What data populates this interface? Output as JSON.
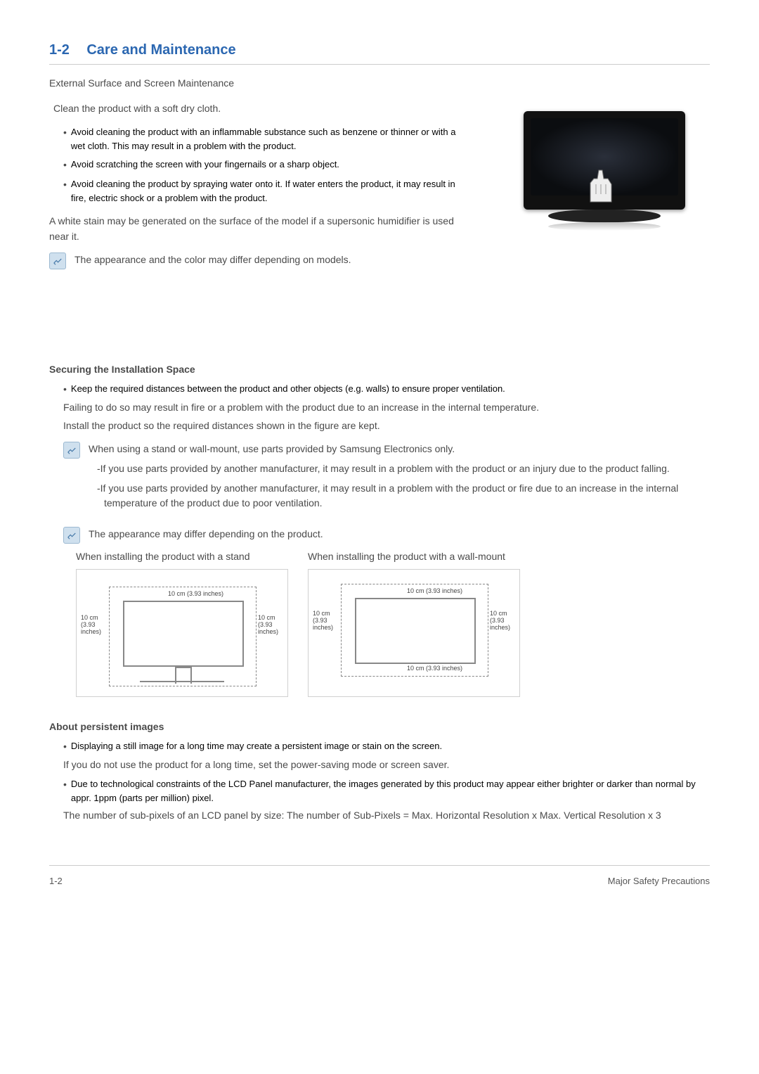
{
  "header": {
    "number": "1-2",
    "title": "Care and Maintenance"
  },
  "section1": {
    "subhead": "External Surface and Screen Maintenance",
    "intro": "Clean the product with a soft dry cloth.",
    "bullets": [
      "Avoid cleaning the product with an inflammable substance such as benzene or thinner or with a wet cloth. This may result in a problem with the product.",
      "Avoid scratching the screen with your fingernails or a sharp object.",
      "Avoid cleaning the product by spraying water onto it. If water enters the product, it may result in fire, electric shock or a problem with the product."
    ],
    "white_stain": "A white stain may be generated on the surface of the model if a supersonic humidifier is used near it.",
    "note1": "The appearance and the color may differ depending on models."
  },
  "section2": {
    "title": "Securing the Installation Space",
    "bullet1": "Keep the required distances between the product and other objects (e.g. walls) to ensure proper ventilation.",
    "p1": "Failing to do so may result in fire or a problem with the product due to an increase in the internal temperature.",
    "p2": "Install the product so the required distances shown in the figure are kept.",
    "note_main": "When using a stand or wall-mount, use parts provided by Samsung Electronics only.",
    "note_sub1": "-If you use parts provided by another manufacturer, it may result in a problem with the product or an injury due to the product falling.",
    "note_sub2": "-If you use parts provided by another manufacturer, it may result in a problem with the product or fire due to an increase in the internal temperature of the product due to poor ventilation.",
    "note2": "The appearance may differ depending on the product.",
    "fig1_caption": "When installing the product with a stand",
    "fig2_caption": "When installing the product with a wall-mount",
    "dim_top": "10 cm (3.93 inches)",
    "dim_side": "10 cm\n(3.93\ninches)",
    "dim_bottom": "10 cm (3.93 inches)"
  },
  "section3": {
    "title": "About persistent images",
    "bullet1": "Displaying a still image for a long time may create a persistent image or stain on the screen.",
    "p1": "If you do not use the product for a long time, set the power-saving mode or screen saver.",
    "bullet2": "Due to technological constraints of the LCD Panel manufacturer, the images generated by this product may appear either brighter or darker than normal by appr. 1ppm (parts per million) pixel.",
    "p2": "The number of sub-pixels of an LCD panel by size:  The number of Sub-Pixels = Max. Horizontal Resolution x Max. Vertical Resolution x 3"
  },
  "footer": {
    "left": "1-2",
    "right": "Major Safety Precautions"
  }
}
